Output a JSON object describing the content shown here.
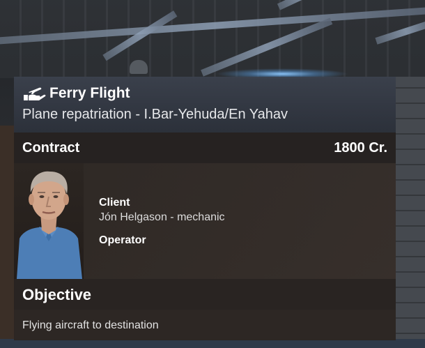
{
  "mission": {
    "icon": "hand-with-plane-icon",
    "title": "Ferry Flight",
    "subtitle": "Plane repatriation - I.Bar-Yehuda/En Yahav"
  },
  "contract": {
    "label": "Contract",
    "value": "1800 Cr."
  },
  "client": {
    "label": "Client",
    "name": "Jón Helgason - mechanic",
    "operator_label": "Operator"
  },
  "objective": {
    "label": "Objective",
    "text": "Flying aircraft to destination"
  }
}
